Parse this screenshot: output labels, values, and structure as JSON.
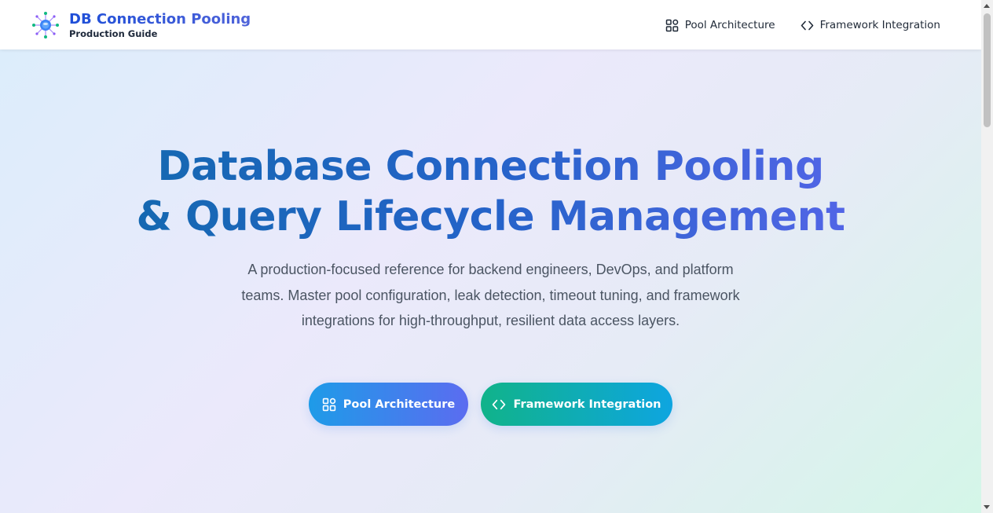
{
  "brand": {
    "title": "DB Connection Pooling",
    "subtitle": "Production Guide",
    "logo_icon": "network-node-icon"
  },
  "nav": {
    "items": [
      {
        "label": "Pool Architecture",
        "icon": "grid-icon"
      },
      {
        "label": "Framework Integration",
        "icon": "code-icon"
      }
    ]
  },
  "hero": {
    "title_line1": "Database Connection Pooling",
    "title_line2": "& Query Lifecycle Management",
    "description": "A production-focused reference for backend engineers, DevOps, and platform teams. Master pool configuration, leak detection, timeout tuning, and framework integrations for high-throughput, resilient data access layers.",
    "buttons": [
      {
        "label": "Pool Architecture",
        "icon": "grid-icon"
      },
      {
        "label": "Framework Integration",
        "icon": "code-icon"
      }
    ]
  },
  "colors": {
    "brand_blue": "#2563eb",
    "accent_indigo": "#6366f1",
    "accent_teal": "#10b38a",
    "accent_sky": "#0ea5e0"
  }
}
